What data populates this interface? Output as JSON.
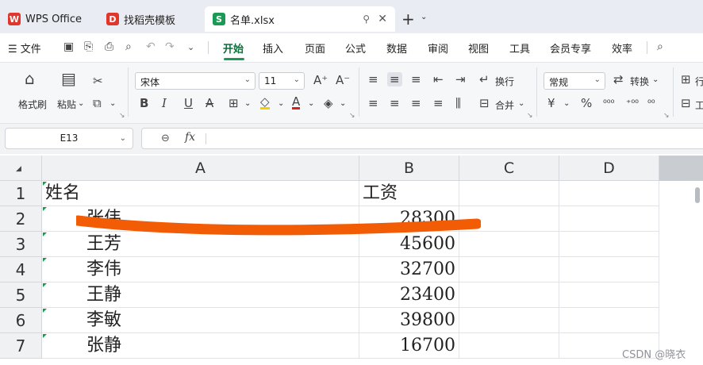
{
  "tabs": [
    {
      "label": "WPS Office",
      "logo_color": "#e0362b"
    },
    {
      "label": "找稻壳模板",
      "logo_color": "#e0362b"
    },
    {
      "label": "名单.xlsx",
      "logo_color": "#1a9a54",
      "logo_letter": "S"
    }
  ],
  "menu": {
    "file_label": "文件",
    "items": [
      "开始",
      "插入",
      "页面",
      "公式",
      "数据",
      "审阅",
      "视图",
      "工具",
      "会员专享",
      "效率"
    ],
    "active": "开始"
  },
  "ribbon": {
    "format_painter": "格式刷",
    "paste": "粘贴",
    "font_name": "宋体",
    "font_size": "11",
    "wrap": "换行",
    "merge": "合并",
    "number_format": "常规",
    "convert": "转换",
    "percent": "%",
    "row_col_label": "行",
    "worksheet_label": "工"
  },
  "formula_bar": {
    "cell_ref": "E13",
    "fx": "fx",
    "content": ""
  },
  "sheet": {
    "columns": [
      "A",
      "B",
      "C",
      "D"
    ],
    "rows": [
      "1",
      "2",
      "3",
      "4",
      "5",
      "6",
      "7"
    ],
    "header_row": {
      "name": "姓名",
      "salary": "工资"
    },
    "data": [
      {
        "name": "张伟",
        "salary": "28300"
      },
      {
        "name": "王芳",
        "salary": "45600"
      },
      {
        "name": "李伟",
        "salary": "32700"
      },
      {
        "name": "王静",
        "salary": "23400"
      },
      {
        "name": "李敏",
        "salary": "39800"
      },
      {
        "name": "张静",
        "salary": "16700"
      }
    ],
    "annotation_color": "#f25c05"
  },
  "watermark": "CSDN @晓衣"
}
